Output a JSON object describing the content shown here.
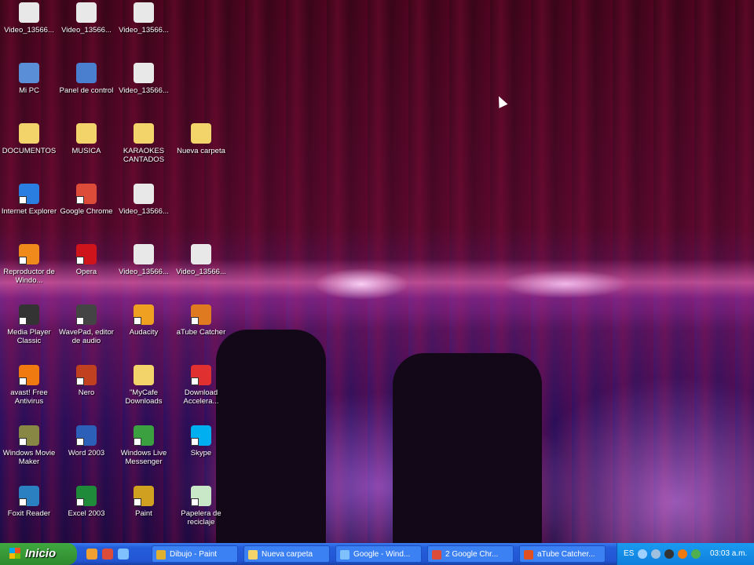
{
  "desktop": {
    "icons": [
      {
        "label": "Video_13566...",
        "icon": "video-file-icon",
        "color": "#e8e8e8",
        "col": 0,
        "row": 0
      },
      {
        "label": "Video_13566...",
        "icon": "video-file-icon",
        "color": "#e8e8e8",
        "col": 1,
        "row": 0
      },
      {
        "label": "Video_13566...",
        "icon": "video-file-icon",
        "color": "#e8e8e8",
        "col": 2,
        "row": 0
      },
      {
        "label": "Mi PC",
        "icon": "my-computer-icon",
        "color": "#5a8fd8",
        "col": 0,
        "row": 1
      },
      {
        "label": "Panel de control",
        "icon": "control-panel-icon",
        "color": "#4a7fd0",
        "col": 1,
        "row": 1
      },
      {
        "label": "Video_13566...",
        "icon": "video-file-icon",
        "color": "#e8e8e8",
        "col": 2,
        "row": 1
      },
      {
        "label": "DOCUMENTOS",
        "icon": "folder-icon",
        "color": "#f3d46a",
        "col": 0,
        "row": 2
      },
      {
        "label": "MUSICA",
        "icon": "folder-icon",
        "color": "#f3d46a",
        "col": 1,
        "row": 2
      },
      {
        "label": "KARAOKES CANTADOS",
        "icon": "folder-icon",
        "color": "#f3d46a",
        "col": 2,
        "row": 2
      },
      {
        "label": "Nueva carpeta",
        "icon": "folder-icon",
        "color": "#f3d46a",
        "col": 3,
        "row": 2
      },
      {
        "label": "Internet Explorer",
        "icon": "internet-explorer-icon",
        "color": "#2a7de1",
        "col": 0,
        "row": 3
      },
      {
        "label": "Google Chrome",
        "icon": "chrome-icon",
        "color": "#dd4b39",
        "col": 1,
        "row": 3
      },
      {
        "label": "Video_13566...",
        "icon": "video-file-icon",
        "color": "#e8e8e8",
        "col": 2,
        "row": 3
      },
      {
        "label": "Reproductor de Windo...",
        "icon": "media-player-icon",
        "color": "#f08a1a",
        "col": 0,
        "row": 4
      },
      {
        "label": "Opera",
        "icon": "opera-icon",
        "color": "#d0141c",
        "col": 1,
        "row": 4
      },
      {
        "label": "Video_13566...",
        "icon": "video-file-icon",
        "color": "#e8e8e8",
        "col": 2,
        "row": 4
      },
      {
        "label": "Video_13566...",
        "icon": "video-file-icon",
        "color": "#e8e8e8",
        "col": 3,
        "row": 4
      },
      {
        "label": "Media Player Classic",
        "icon": "mpc-icon",
        "color": "#333333",
        "col": 0,
        "row": 5
      },
      {
        "label": "WavePad, editor de audio",
        "icon": "wavepad-icon",
        "color": "#444444",
        "col": 1,
        "row": 5
      },
      {
        "label": "Audacity",
        "icon": "audacity-icon",
        "color": "#f0a020",
        "col": 2,
        "row": 5
      },
      {
        "label": "aTube Catcher",
        "icon": "atube-catcher-icon",
        "color": "#e07a20",
        "col": 3,
        "row": 5
      },
      {
        "label": "avast! Free Antivirus",
        "icon": "avast-icon",
        "color": "#f07a10",
        "col": 0,
        "row": 6
      },
      {
        "label": "Nero",
        "icon": "nero-icon",
        "color": "#c04020",
        "col": 1,
        "row": 6
      },
      {
        "label": "\"MyCafe Downloads",
        "icon": "folder-icon",
        "color": "#f3d46a",
        "col": 2,
        "row": 6
      },
      {
        "label": "Download Accelera...",
        "icon": "download-accelerator-icon",
        "color": "#e03030",
        "col": 3,
        "row": 6
      },
      {
        "label": "Windows Movie Maker",
        "icon": "movie-maker-icon",
        "color": "#888844",
        "col": 0,
        "row": 7
      },
      {
        "label": "Word 2003",
        "icon": "word-icon",
        "color": "#2b5fb8",
        "col": 1,
        "row": 7
      },
      {
        "label": "Windows Live Messenger",
        "icon": "messenger-icon",
        "color": "#3aa040",
        "col": 2,
        "row": 7
      },
      {
        "label": "Skype",
        "icon": "skype-icon",
        "color": "#00aff0",
        "col": 3,
        "row": 7
      },
      {
        "label": "Foxit Reader",
        "icon": "foxit-reader-icon",
        "color": "#2a80c0",
        "col": 0,
        "row": 8
      },
      {
        "label": "Excel 2003",
        "icon": "excel-icon",
        "color": "#1e8a3a",
        "col": 1,
        "row": 8
      },
      {
        "label": "Paint",
        "icon": "paint-icon",
        "color": "#d0a020",
        "col": 2,
        "row": 8
      },
      {
        "label": "Papelera de reciclaje",
        "icon": "recycle-bin-icon",
        "color": "#c8e8c8",
        "col": 3,
        "row": 8
      }
    ]
  },
  "taskbar": {
    "start_label": "Inicio",
    "quick_launch": [
      {
        "icon": "foxit-icon",
        "color": "#f0a030"
      },
      {
        "icon": "chrome-icon",
        "color": "#dd4b39"
      },
      {
        "icon": "internet-explorer-icon",
        "color": "#7fc0ff"
      }
    ],
    "tasks": [
      {
        "label": "Dibujo - Paint",
        "icon": "paint-icon",
        "color": "#e0b030"
      },
      {
        "label": "Nueva carpeta",
        "icon": "folder-icon",
        "color": "#f3d46a"
      },
      {
        "label": "Google - Wind...",
        "icon": "internet-explorer-icon",
        "color": "#7fc0ff"
      },
      {
        "label": "2 Google Chr...",
        "icon": "chrome-icon",
        "color": "#dd4b39"
      },
      {
        "label": "aTube Catcher...",
        "icon": "atube-catcher-icon",
        "color": "#e05020"
      }
    ],
    "tray": {
      "language": "ES",
      "clock": "03:03 a.m.",
      "icons": [
        {
          "icon": "arrow-icon",
          "color": "#9fd0ff"
        },
        {
          "icon": "network-icon",
          "color": "#a0c0e0"
        },
        {
          "icon": "skype-tray-icon",
          "color": "#333"
        },
        {
          "icon": "avast-tray-icon",
          "color": "#f07a10"
        },
        {
          "icon": "messenger-tray-icon",
          "color": "#50b050"
        }
      ]
    }
  }
}
